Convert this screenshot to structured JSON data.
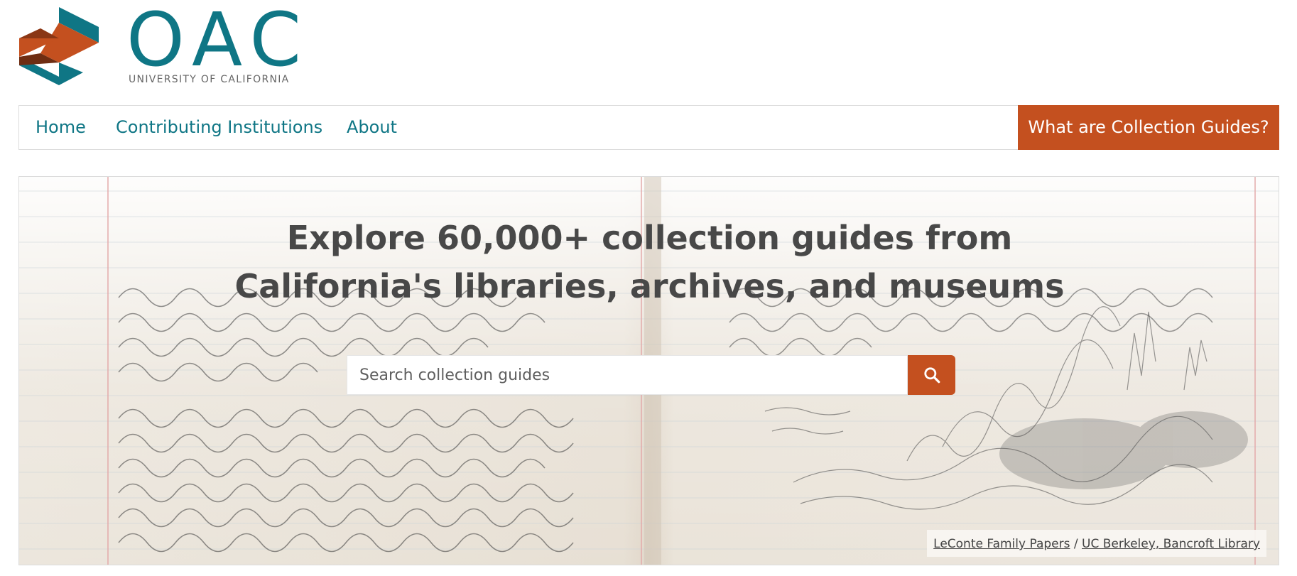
{
  "logo": {
    "wordmark": "OAC",
    "subtitle": "UNIVERSITY OF CALIFORNIA"
  },
  "nav": {
    "items": [
      {
        "label": "Home"
      },
      {
        "label": "Contributing Institutions"
      },
      {
        "label": "About"
      }
    ],
    "cta_label": "What are Collection Guides?"
  },
  "hero": {
    "title_line1": "Explore 60,000+ collection guides from",
    "title_line2": "California's libraries, archives, and museums",
    "search": {
      "placeholder": "Search collection guides",
      "value": "",
      "button_icon": "search-icon"
    },
    "credit": {
      "collection": "LeConte Family Papers",
      "separator": "/",
      "institution": "UC Berkeley, Bancroft Library"
    }
  },
  "colors": {
    "brand_teal": "#0f7685",
    "accent_orange": "#c4501f",
    "heading_gray": "#484848"
  }
}
